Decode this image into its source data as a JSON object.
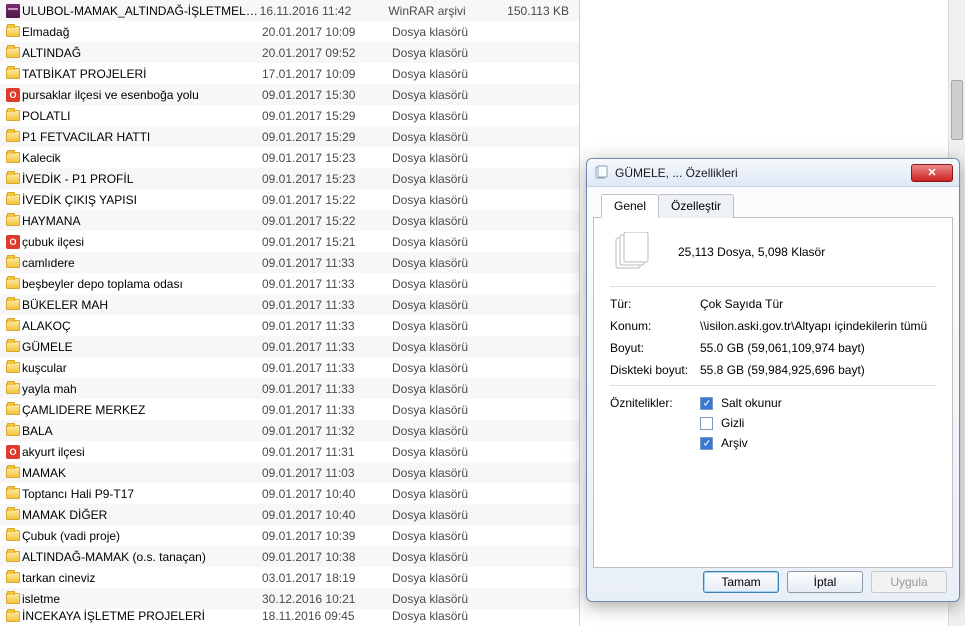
{
  "files": [
    {
      "icon": "rar",
      "name": "ULUBOL-MAMAK_ALTINDAĞ-İŞLETMELER",
      "date": "16.11.2016 11:42",
      "type": "WinRAR arşivi",
      "size": "150.113 KB",
      "bold": true
    },
    {
      "icon": "folder",
      "name": "Elmadağ",
      "date": "20.01.2017 10:09",
      "type": "Dosya klasörü",
      "size": ""
    },
    {
      "icon": "folder",
      "name": "ALTINDAĞ",
      "date": "20.01.2017 09:52",
      "type": "Dosya klasörü",
      "size": ""
    },
    {
      "icon": "folder",
      "name": "TATBİKAT PROJELERİ",
      "date": "17.01.2017 10:09",
      "type": "Dosya klasörü",
      "size": ""
    },
    {
      "icon": "red",
      "name": "pursaklar ilçesi ve esenboğa yolu",
      "date": "09.01.2017 15:30",
      "type": "Dosya klasörü",
      "size": ""
    },
    {
      "icon": "folder",
      "name": "POLATLI",
      "date": "09.01.2017 15:29",
      "type": "Dosya klasörü",
      "size": ""
    },
    {
      "icon": "folder",
      "name": "P1 FETVACILAR HATTI",
      "date": "09.01.2017 15:29",
      "type": "Dosya klasörü",
      "size": ""
    },
    {
      "icon": "folder",
      "name": "Kalecik",
      "date": "09.01.2017 15:23",
      "type": "Dosya klasörü",
      "size": ""
    },
    {
      "icon": "folder",
      "name": "İVEDİK - P1 PROFİL",
      "date": "09.01.2017 15:23",
      "type": "Dosya klasörü",
      "size": ""
    },
    {
      "icon": "folder",
      "name": "İVEDİK ÇIKIŞ YAPISI",
      "date": "09.01.2017 15:22",
      "type": "Dosya klasörü",
      "size": ""
    },
    {
      "icon": "folder",
      "name": "HAYMANA",
      "date": "09.01.2017 15:22",
      "type": "Dosya klasörü",
      "size": ""
    },
    {
      "icon": "red",
      "name": "çubuk ilçesi",
      "date": "09.01.2017 15:21",
      "type": "Dosya klasörü",
      "size": ""
    },
    {
      "icon": "folder",
      "name": "camlıdere",
      "date": "09.01.2017 11:33",
      "type": "Dosya klasörü",
      "size": ""
    },
    {
      "icon": "folder",
      "name": "beşbeyler depo toplama odası",
      "date": "09.01.2017 11:33",
      "type": "Dosya klasörü",
      "size": ""
    },
    {
      "icon": "folder",
      "name": "BÜKELER MAH",
      "date": "09.01.2017 11:33",
      "type": "Dosya klasörü",
      "size": ""
    },
    {
      "icon": "folder",
      "name": "ALAKOÇ",
      "date": "09.01.2017 11:33",
      "type": "Dosya klasörü",
      "size": ""
    },
    {
      "icon": "folder",
      "name": "GÜMELE",
      "date": "09.01.2017 11:33",
      "type": "Dosya klasörü",
      "size": ""
    },
    {
      "icon": "folder",
      "name": "kuşcular",
      "date": "09.01.2017 11:33",
      "type": "Dosya klasörü",
      "size": ""
    },
    {
      "icon": "folder",
      "name": "yayla mah",
      "date": "09.01.2017 11:33",
      "type": "Dosya klasörü",
      "size": ""
    },
    {
      "icon": "folder",
      "name": "ÇAMLIDERE MERKEZ",
      "date": "09.01.2017 11:33",
      "type": "Dosya klasörü",
      "size": ""
    },
    {
      "icon": "folder",
      "name": "BALA",
      "date": "09.01.2017 11:32",
      "type": "Dosya klasörü",
      "size": ""
    },
    {
      "icon": "red",
      "name": "akyurt ilçesi",
      "date": "09.01.2017 11:31",
      "type": "Dosya klasörü",
      "size": ""
    },
    {
      "icon": "folder",
      "name": "MAMAK",
      "date": "09.01.2017 11:03",
      "type": "Dosya klasörü",
      "size": ""
    },
    {
      "icon": "folder",
      "name": "Toptancı Hali P9-T17",
      "date": "09.01.2017 10:40",
      "type": "Dosya klasörü",
      "size": ""
    },
    {
      "icon": "folder",
      "name": "MAMAK DİĞER",
      "date": "09.01.2017 10:40",
      "type": "Dosya klasörü",
      "size": ""
    },
    {
      "icon": "folder",
      "name": "Çubuk (vadi proje)",
      "date": "09.01.2017 10:39",
      "type": "Dosya klasörü",
      "size": ""
    },
    {
      "icon": "folder",
      "name": "ALTINDAĞ-MAMAK (o.s. tanaçan)",
      "date": "09.01.2017 10:38",
      "type": "Dosya klasörü",
      "size": ""
    },
    {
      "icon": "folder",
      "name": "tarkan cineviz",
      "date": "03.01.2017 18:19",
      "type": "Dosya klasörü",
      "size": ""
    },
    {
      "icon": "folder",
      "name": "isletme",
      "date": "30.12.2016 10:21",
      "type": "Dosya klasörü",
      "size": ""
    },
    {
      "icon": "folder",
      "name": "İNCEKAYA İŞLETME PROJELERİ",
      "date": "18.11.2016 09:45",
      "type": "Dosya klasörü",
      "size": ""
    }
  ],
  "dialog": {
    "title": "GÜMELE, ... Özellikleri",
    "tabs": {
      "genel": "Genel",
      "ozellestir": "Özelleştir"
    },
    "summary": "25,113 Dosya, 5,098 Klasör",
    "labels": {
      "tur": "Tür:",
      "konum": "Konum:",
      "boyut": "Boyut:",
      "disk": "Diskteki boyut:",
      "oznitelikler": "Öznitelikler:"
    },
    "values": {
      "tur": "Çok Sayıda Tür",
      "konum": "\\\\isilon.aski.gov.tr\\Altyapı içindekilerin tümü",
      "boyut": "55.0 GB (59,061,109,974 bayt)",
      "disk": "55.8 GB (59,984,925,696 bayt)"
    },
    "attrs": {
      "salt": "Salt okunur",
      "gizli": "Gizli",
      "arsiv": "Arşiv"
    },
    "buttons": {
      "ok": "Tamam",
      "cancel": "İptal",
      "apply": "Uygula"
    }
  }
}
